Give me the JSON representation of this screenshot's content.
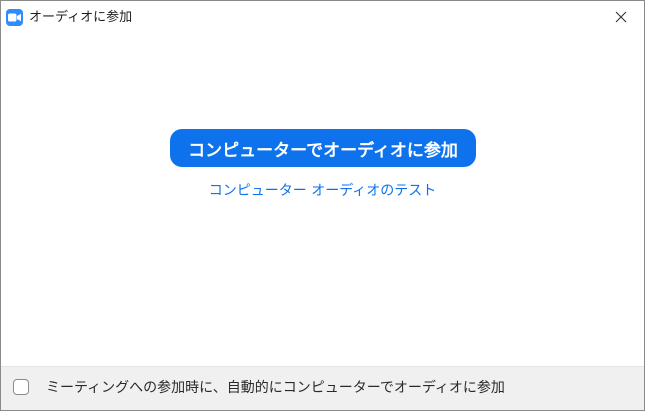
{
  "window": {
    "title": "オーディオに参加",
    "app_icon": "zoom-camera-icon",
    "close_icon": "close-icon"
  },
  "main": {
    "join_button_label": "コンピューターでオーディオに参加",
    "test_link_label": "コンピューター オーディオのテスト"
  },
  "footer": {
    "auto_join_label": "ミーティングへの参加時に、自動的にコンピューターでオーディオに参加",
    "auto_join_checked": false
  },
  "colors": {
    "accent": "#0e72ed",
    "app_icon_bg": "#2d8cff",
    "footer_bg": "#f0f0f0"
  }
}
